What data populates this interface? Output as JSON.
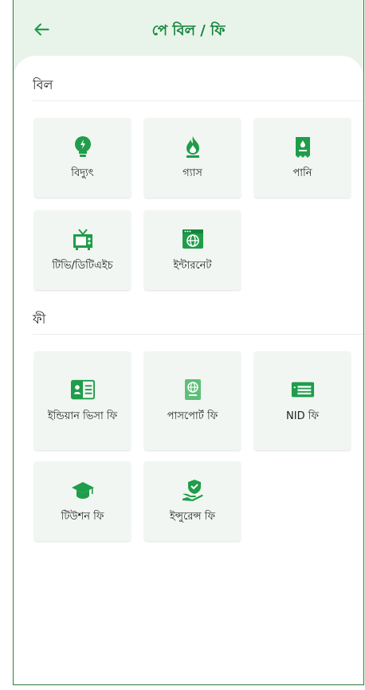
{
  "header": {
    "title": "পে বিল / ফি"
  },
  "bill_section": {
    "title": "বিল",
    "tiles": [
      {
        "label": "বিদ্যুৎ",
        "icon": "lightbulb-icon"
      },
      {
        "label": "গ্যাস",
        "icon": "flame-icon"
      },
      {
        "label": "পানি",
        "icon": "water-bill-icon"
      },
      {
        "label": "টিভি/ডিটিএইচ",
        "icon": "tv-icon"
      },
      {
        "label": "ইন্টারনেট",
        "icon": "internet-icon"
      }
    ]
  },
  "fee_section": {
    "title": "ফী",
    "tiles": [
      {
        "label": "ইন্ডিয়ান ভিসা ফি",
        "icon": "visa-icon"
      },
      {
        "label": "পাসপোর্ট ফি",
        "icon": "passport-icon"
      },
      {
        "label": "NID ফি",
        "icon": "id-card-icon"
      },
      {
        "label": "টিউশন ফি",
        "icon": "graduation-cap-icon"
      },
      {
        "label": "ইন্সুরেন্স ফি",
        "icon": "insurance-icon"
      }
    ]
  },
  "colors": {
    "accent": "#1f9d4a",
    "tile_bg": "#f1f6f2",
    "header_bg": "#e8f4ea"
  }
}
